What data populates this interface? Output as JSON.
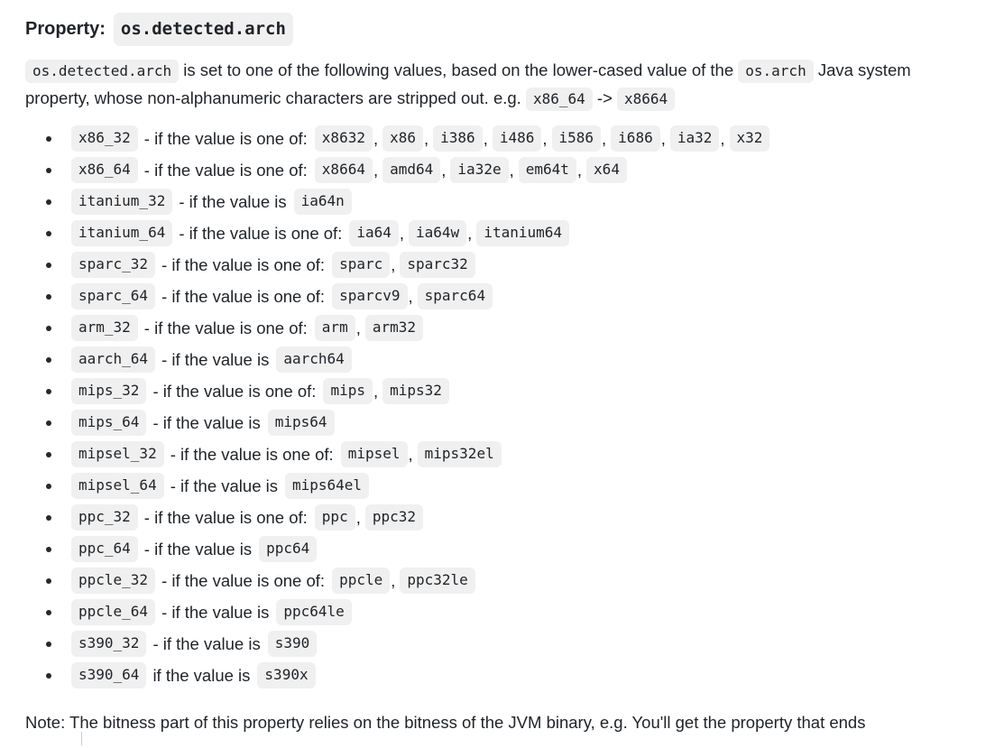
{
  "heading": {
    "label": "Property:",
    "property_name": "os.detected.arch"
  },
  "intro": {
    "code_1": "os.detected.arch",
    "text_1": "is set to one of the following values, based on the lower-cased value of the",
    "code_2": "os.arch",
    "text_2": "Java system property, whose non-alphanumeric characters are stripped out. e.g.",
    "code_3": "x86_64",
    "arrow": "->",
    "code_4": "x8664"
  },
  "list": [
    {
      "name": "x86_32",
      "desc": "- if the value is one of:",
      "values": [
        "x8632",
        "x86",
        "i386",
        "i486",
        "i586",
        "i686",
        "ia32",
        "x32"
      ]
    },
    {
      "name": "x86_64",
      "desc": "- if the value is one of:",
      "values": [
        "x8664",
        "amd64",
        "ia32e",
        "em64t",
        "x64"
      ]
    },
    {
      "name": "itanium_32",
      "desc": "- if the value is",
      "values": [
        "ia64n"
      ]
    },
    {
      "name": "itanium_64",
      "desc": "- if the value is one of:",
      "values": [
        "ia64",
        "ia64w",
        "itanium64"
      ]
    },
    {
      "name": "sparc_32",
      "desc": "- if the value is one of:",
      "values": [
        "sparc",
        "sparc32"
      ]
    },
    {
      "name": "sparc_64",
      "desc": "- if the value is one of:",
      "values": [
        "sparcv9",
        "sparc64"
      ]
    },
    {
      "name": "arm_32",
      "desc": "- if the value is one of:",
      "values": [
        "arm",
        "arm32"
      ]
    },
    {
      "name": "aarch_64",
      "desc": "- if the value is",
      "values": [
        "aarch64"
      ]
    },
    {
      "name": "mips_32",
      "desc": "- if the value is one of:",
      "values": [
        "mips",
        "mips32"
      ]
    },
    {
      "name": "mips_64",
      "desc": "- if the value is",
      "values": [
        "mips64"
      ]
    },
    {
      "name": "mipsel_32",
      "desc": "- if the value is one of:",
      "values": [
        "mipsel",
        "mips32el"
      ]
    },
    {
      "name": "mipsel_64",
      "desc": "- if the value is",
      "values": [
        "mips64el"
      ]
    },
    {
      "name": "ppc_32",
      "desc": "- if the value is one of:",
      "values": [
        "ppc",
        "ppc32"
      ]
    },
    {
      "name": "ppc_64",
      "desc": "- if the value is",
      "values": [
        "ppc64"
      ]
    },
    {
      "name": "ppcle_32",
      "desc": "- if the value is one of:",
      "values": [
        "ppcle",
        "ppc32le"
      ]
    },
    {
      "name": "ppcle_64",
      "desc": "- if the value is",
      "values": [
        "ppc64le"
      ]
    },
    {
      "name": "s390_32",
      "desc": "- if the value is",
      "values": [
        "s390"
      ]
    },
    {
      "name": "s390_64",
      "desc": "if the value is",
      "values": [
        "s390x"
      ]
    }
  ],
  "note": "Note: The bitness part of this property relies on the bitness of the JVM binary, e.g. You'll get the property that ends",
  "colors": {
    "text": "#1f2328",
    "code_background": "#f0f0f0",
    "page_background": "#ffffff"
  }
}
